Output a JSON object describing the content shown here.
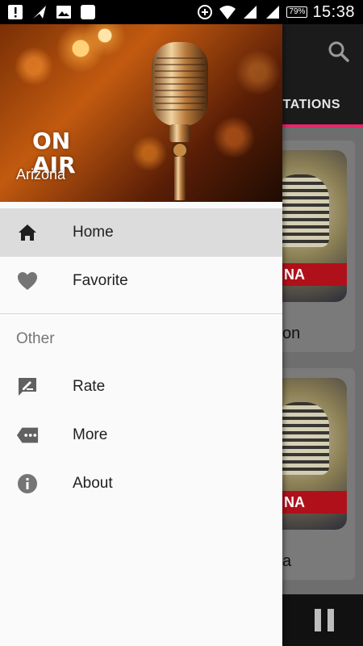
{
  "status_bar": {
    "time": "15:38",
    "battery": "79%",
    "icons": [
      "notification-alert-icon",
      "send-icon",
      "image-icon",
      "app-icon",
      "data-saver-icon",
      "wifi-icon",
      "signal-icon",
      "signal-2-icon",
      "battery-icon"
    ]
  },
  "drawer": {
    "header": {
      "image_text": "ON AIR",
      "subtitle": "Arizona"
    },
    "items": [
      {
        "label": "Home",
        "icon": "home-icon",
        "active": true
      },
      {
        "label": "Favorite",
        "icon": "heart-icon",
        "active": false
      }
    ],
    "section_title": "Other",
    "other_items": [
      {
        "label": "Rate",
        "icon": "rate-icon"
      },
      {
        "label": "More",
        "icon": "more-icon"
      },
      {
        "label": "About",
        "icon": "info-icon"
      }
    ]
  },
  "background": {
    "tab_label": "STATIONS",
    "card_titles": [
      "on",
      "a"
    ],
    "card_band": "NA",
    "colors": {
      "toolbar": "#1b1b1b",
      "accent": "#e7266a",
      "active_item": "#dcdcdc"
    }
  }
}
